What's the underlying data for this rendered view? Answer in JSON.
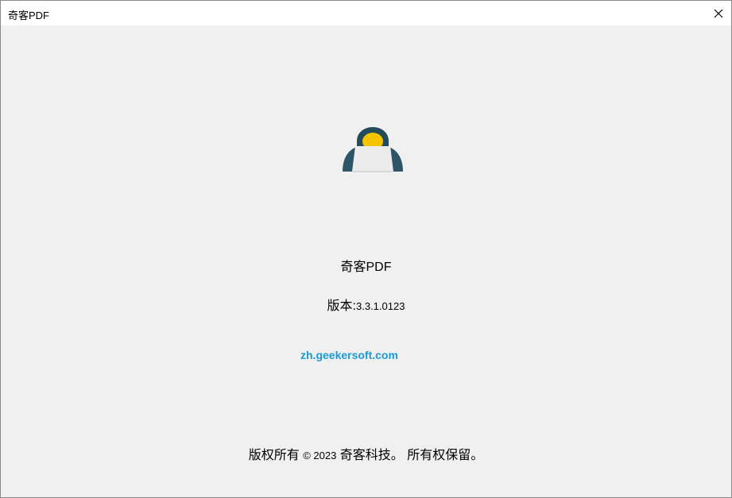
{
  "window": {
    "title": "奇客PDF",
    "close_glyph": "✕"
  },
  "about": {
    "logo_icon": "hacker-avatar-icon",
    "app_name": "奇客PDF",
    "version_label": "版本:",
    "version_number": "3.3.1.0123",
    "website": "zh.geekersoft.com",
    "copyright_prefix": "版权所有 ",
    "copyright_year": "© 2023",
    "copyright_suffix": " 奇客科技。 所有权保留。"
  },
  "colors": {
    "link": "#1a9ad6",
    "logo_dark": "#234b5a",
    "logo_yellow": "#f5c400",
    "background": "#f0f0f0"
  }
}
